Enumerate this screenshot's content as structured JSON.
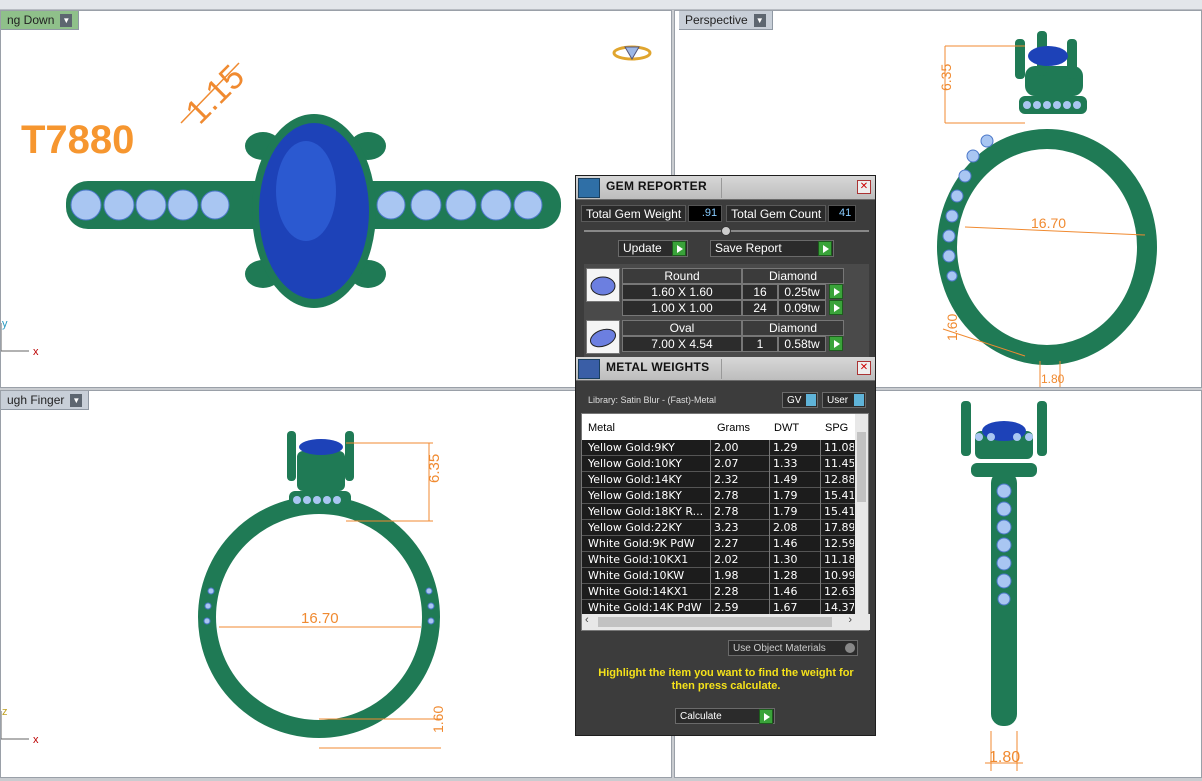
{
  "viewports": {
    "top_left": {
      "tab": "ng Down",
      "label": "T7880",
      "dim": "1.15",
      "axis_y": "y",
      "axis_x": "x"
    },
    "top_right": {
      "tab": "Perspective",
      "dim_height": "6.35",
      "dim_width": "16.70",
      "dim_band": "1.60",
      "dim_bottom": "1.80"
    },
    "bottom_left": {
      "tab": "ugh Finger",
      "dim_height": "6.35",
      "dim_width": "16.70",
      "dim_band": "1.60",
      "axis_z": "z",
      "axis_x": "x"
    },
    "bottom_right": {
      "dim_bottom": "1.80"
    }
  },
  "gem_reporter": {
    "title": "GEM REPORTER",
    "total_gem_weight_label": "Total Gem Weight",
    "total_gem_weight": ".91",
    "total_gem_count_label": "Total Gem Count",
    "total_gem_count": "41",
    "update_label": "Update",
    "save_report_label": "Save Report",
    "groups": [
      {
        "shape": "Round",
        "material": "Diamond",
        "rows": [
          {
            "size": "1.60 X 1.60",
            "count": "16",
            "weight": "0.25tw"
          },
          {
            "size": "1.00 X 1.00",
            "count": "24",
            "weight": "0.09tw"
          }
        ]
      },
      {
        "shape": "Oval",
        "material": "Diamond",
        "rows": [
          {
            "size": "7.00 X 4.54",
            "count": "1",
            "weight": "0.58tw"
          }
        ]
      }
    ]
  },
  "metal_weights": {
    "title": "METAL WEIGHTS",
    "library": "Library: Satin Blur - (Fast)-Metal",
    "gv_label": "GV",
    "user_label": "User",
    "columns": [
      "Metal",
      "Grams",
      "DWT",
      "SPG"
    ],
    "rows": [
      [
        "Yellow Gold:9KY",
        "2.00",
        "1.29",
        "11.08"
      ],
      [
        "Yellow Gold:10KY",
        "2.07",
        "1.33",
        "11.45"
      ],
      [
        "Yellow Gold:14KY",
        "2.32",
        "1.49",
        "12.88"
      ],
      [
        "Yellow Gold:18KY",
        "2.78",
        "1.79",
        "15.41"
      ],
      [
        "Yellow Gold:18KY R...",
        "2.78",
        "1.79",
        "15.41"
      ],
      [
        "Yellow Gold:22KY",
        "3.23",
        "2.08",
        "17.89"
      ],
      [
        "White Gold:9K PdW",
        "2.27",
        "1.46",
        "12.59"
      ],
      [
        "White Gold:10KX1",
        "2.02",
        "1.30",
        "11.18"
      ],
      [
        "White Gold:10KW",
        "1.98",
        "1.28",
        "10.99"
      ],
      [
        "White Gold:14KX1",
        "2.28",
        "1.46",
        "12.63"
      ],
      [
        "White Gold:14K PdW",
        "2.59",
        "1.67",
        "14.37"
      ]
    ],
    "use_object_materials_label": "Use Object Materials",
    "hint": "Highlight the item you want to find the weight for then press calculate.",
    "calculate_label": "Calculate"
  }
}
